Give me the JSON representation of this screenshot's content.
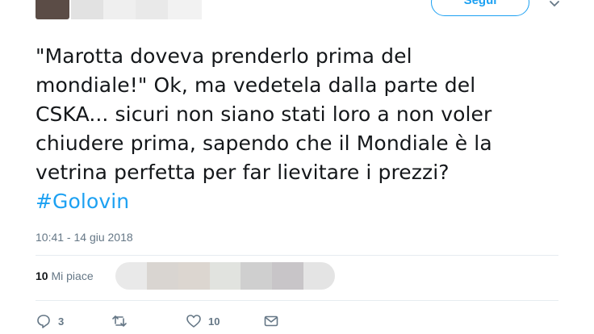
{
  "header": {
    "follow_label": "Segui"
  },
  "tweet": {
    "lines": [
      "\"Marotta doveva prenderlo prima del",
      "mondiale!\" Ok, ma vedetela dalla parte del",
      "CSKA... sicuri non siano stati loro a non voler",
      "chiudere prima, sapendo che il Mondiale è la",
      "vetrina perfetta per far lievitare i prezzi?"
    ],
    "hashtag": "#Golovin",
    "timestamp": "10:41 - 14 giu 2018"
  },
  "stats": {
    "likes_count": "10",
    "likes_label": "Mi piace"
  },
  "actions": {
    "reply_count": "3",
    "like_count": "10"
  },
  "colors": {
    "accent": "#1da1f2",
    "muted": "#657786",
    "text": "#14171a"
  },
  "icons": [
    "chevron-down-icon",
    "reply-icon",
    "retweet-icon",
    "heart-icon",
    "message-icon"
  ]
}
